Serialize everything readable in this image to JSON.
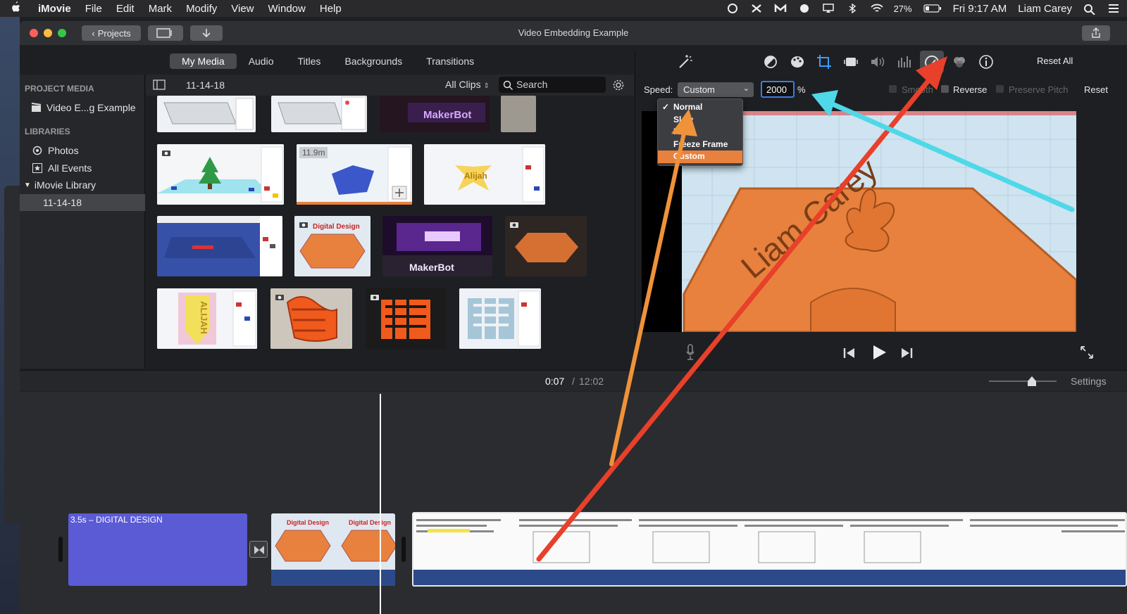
{
  "menubar": {
    "apple": "",
    "app": "iMovie",
    "items": [
      "File",
      "Edit",
      "Mark",
      "Modify",
      "View",
      "Window",
      "Help"
    ],
    "battery": "27%",
    "clock": "Fri 9:17 AM",
    "user": "Liam Carey"
  },
  "window": {
    "title": "Video Embedding Example",
    "projects_button": "Projects"
  },
  "tabs": [
    "My Media",
    "Audio",
    "Titles",
    "Backgrounds",
    "Transitions"
  ],
  "sidebar": {
    "project_media_header": "PROJECT MEDIA",
    "project_item": "Video E...g Example",
    "libraries_header": "LIBRARIES",
    "items": [
      "Photos",
      "All Events",
      "iMovie Library",
      "11-14-18"
    ]
  },
  "browser": {
    "event_name": "11-14-18",
    "filter": "All Clips",
    "search_placeholder": "Search",
    "thumb_duration": "11.9m",
    "labels": {
      "makerbot": "MakerBot",
      "alijah": "Alijah",
      "digital_design": "Digital Design",
      "alijah_vertical": "ALIJAH"
    }
  },
  "viewer": {
    "reset_all": "Reset All",
    "speed_label": "Speed:",
    "speed_value": "Custom",
    "speed_percent": "2000",
    "percent_sign": "%",
    "smooth_label": "Smooth",
    "reverse_label": "Reverse",
    "preserve_pitch_label": "Preserve Pitch",
    "reset_label": "Reset",
    "video_text": "Liam Carey"
  },
  "speed_menu": {
    "options": [
      "Normal",
      "Slow",
      "Fast",
      "Freeze Frame",
      "Custom"
    ],
    "checked": "Normal",
    "highlighted": "Custom"
  },
  "timeline": {
    "current_time": "0:07",
    "separator": "/",
    "total_time": "12:02",
    "settings_label": "Settings",
    "title_clip": "3.5s – DIGITAL DESIGN",
    "clip_caption": "Digital Design"
  },
  "colors": {
    "accent_orange": "#e8813d",
    "title_clip": "#5b5bd6",
    "arrow_red": "#e8402a",
    "arrow_orange": "#f0923a",
    "arrow_cyan": "#4fd8e8",
    "audio_track": "#2c4a8a"
  }
}
